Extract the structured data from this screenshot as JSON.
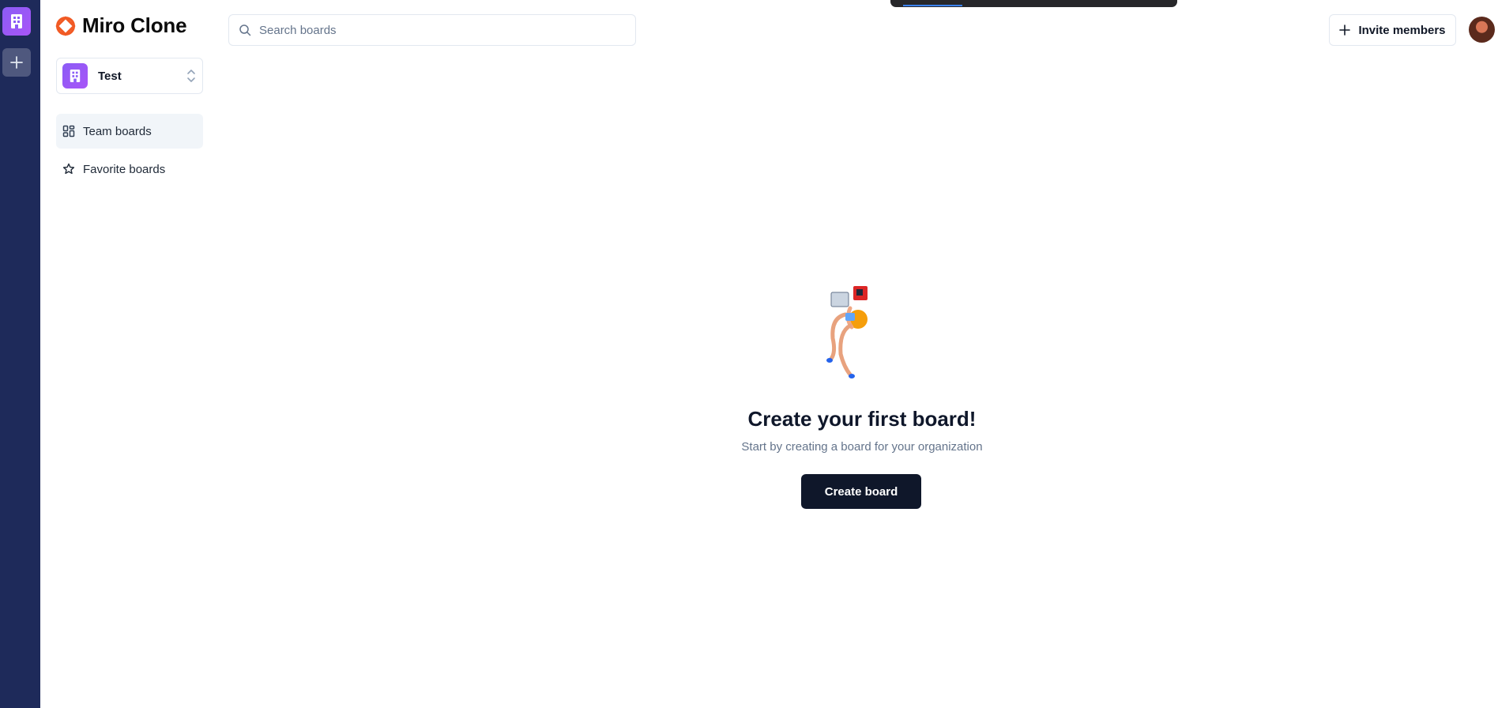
{
  "app": {
    "title": "Miro Clone",
    "brand_color": "#f15a24"
  },
  "rail": {
    "org_icon": "building-icon",
    "add_icon": "plus-icon",
    "bg_color": "#1e2a5a"
  },
  "org_switcher": {
    "name": "Test",
    "icon": "chevrons-up-down-icon"
  },
  "sidebar": {
    "items": [
      {
        "label": "Team boards",
        "icon": "dashboard-icon",
        "active": true
      },
      {
        "label": "Favorite boards",
        "icon": "star-icon",
        "active": false
      }
    ]
  },
  "search": {
    "placeholder": "Search boards",
    "value": ""
  },
  "header": {
    "invite_label": "Invite members"
  },
  "empty_state": {
    "title": "Create your first board!",
    "subtitle": "Start by creating a board for your organization",
    "button_label": "Create board"
  }
}
